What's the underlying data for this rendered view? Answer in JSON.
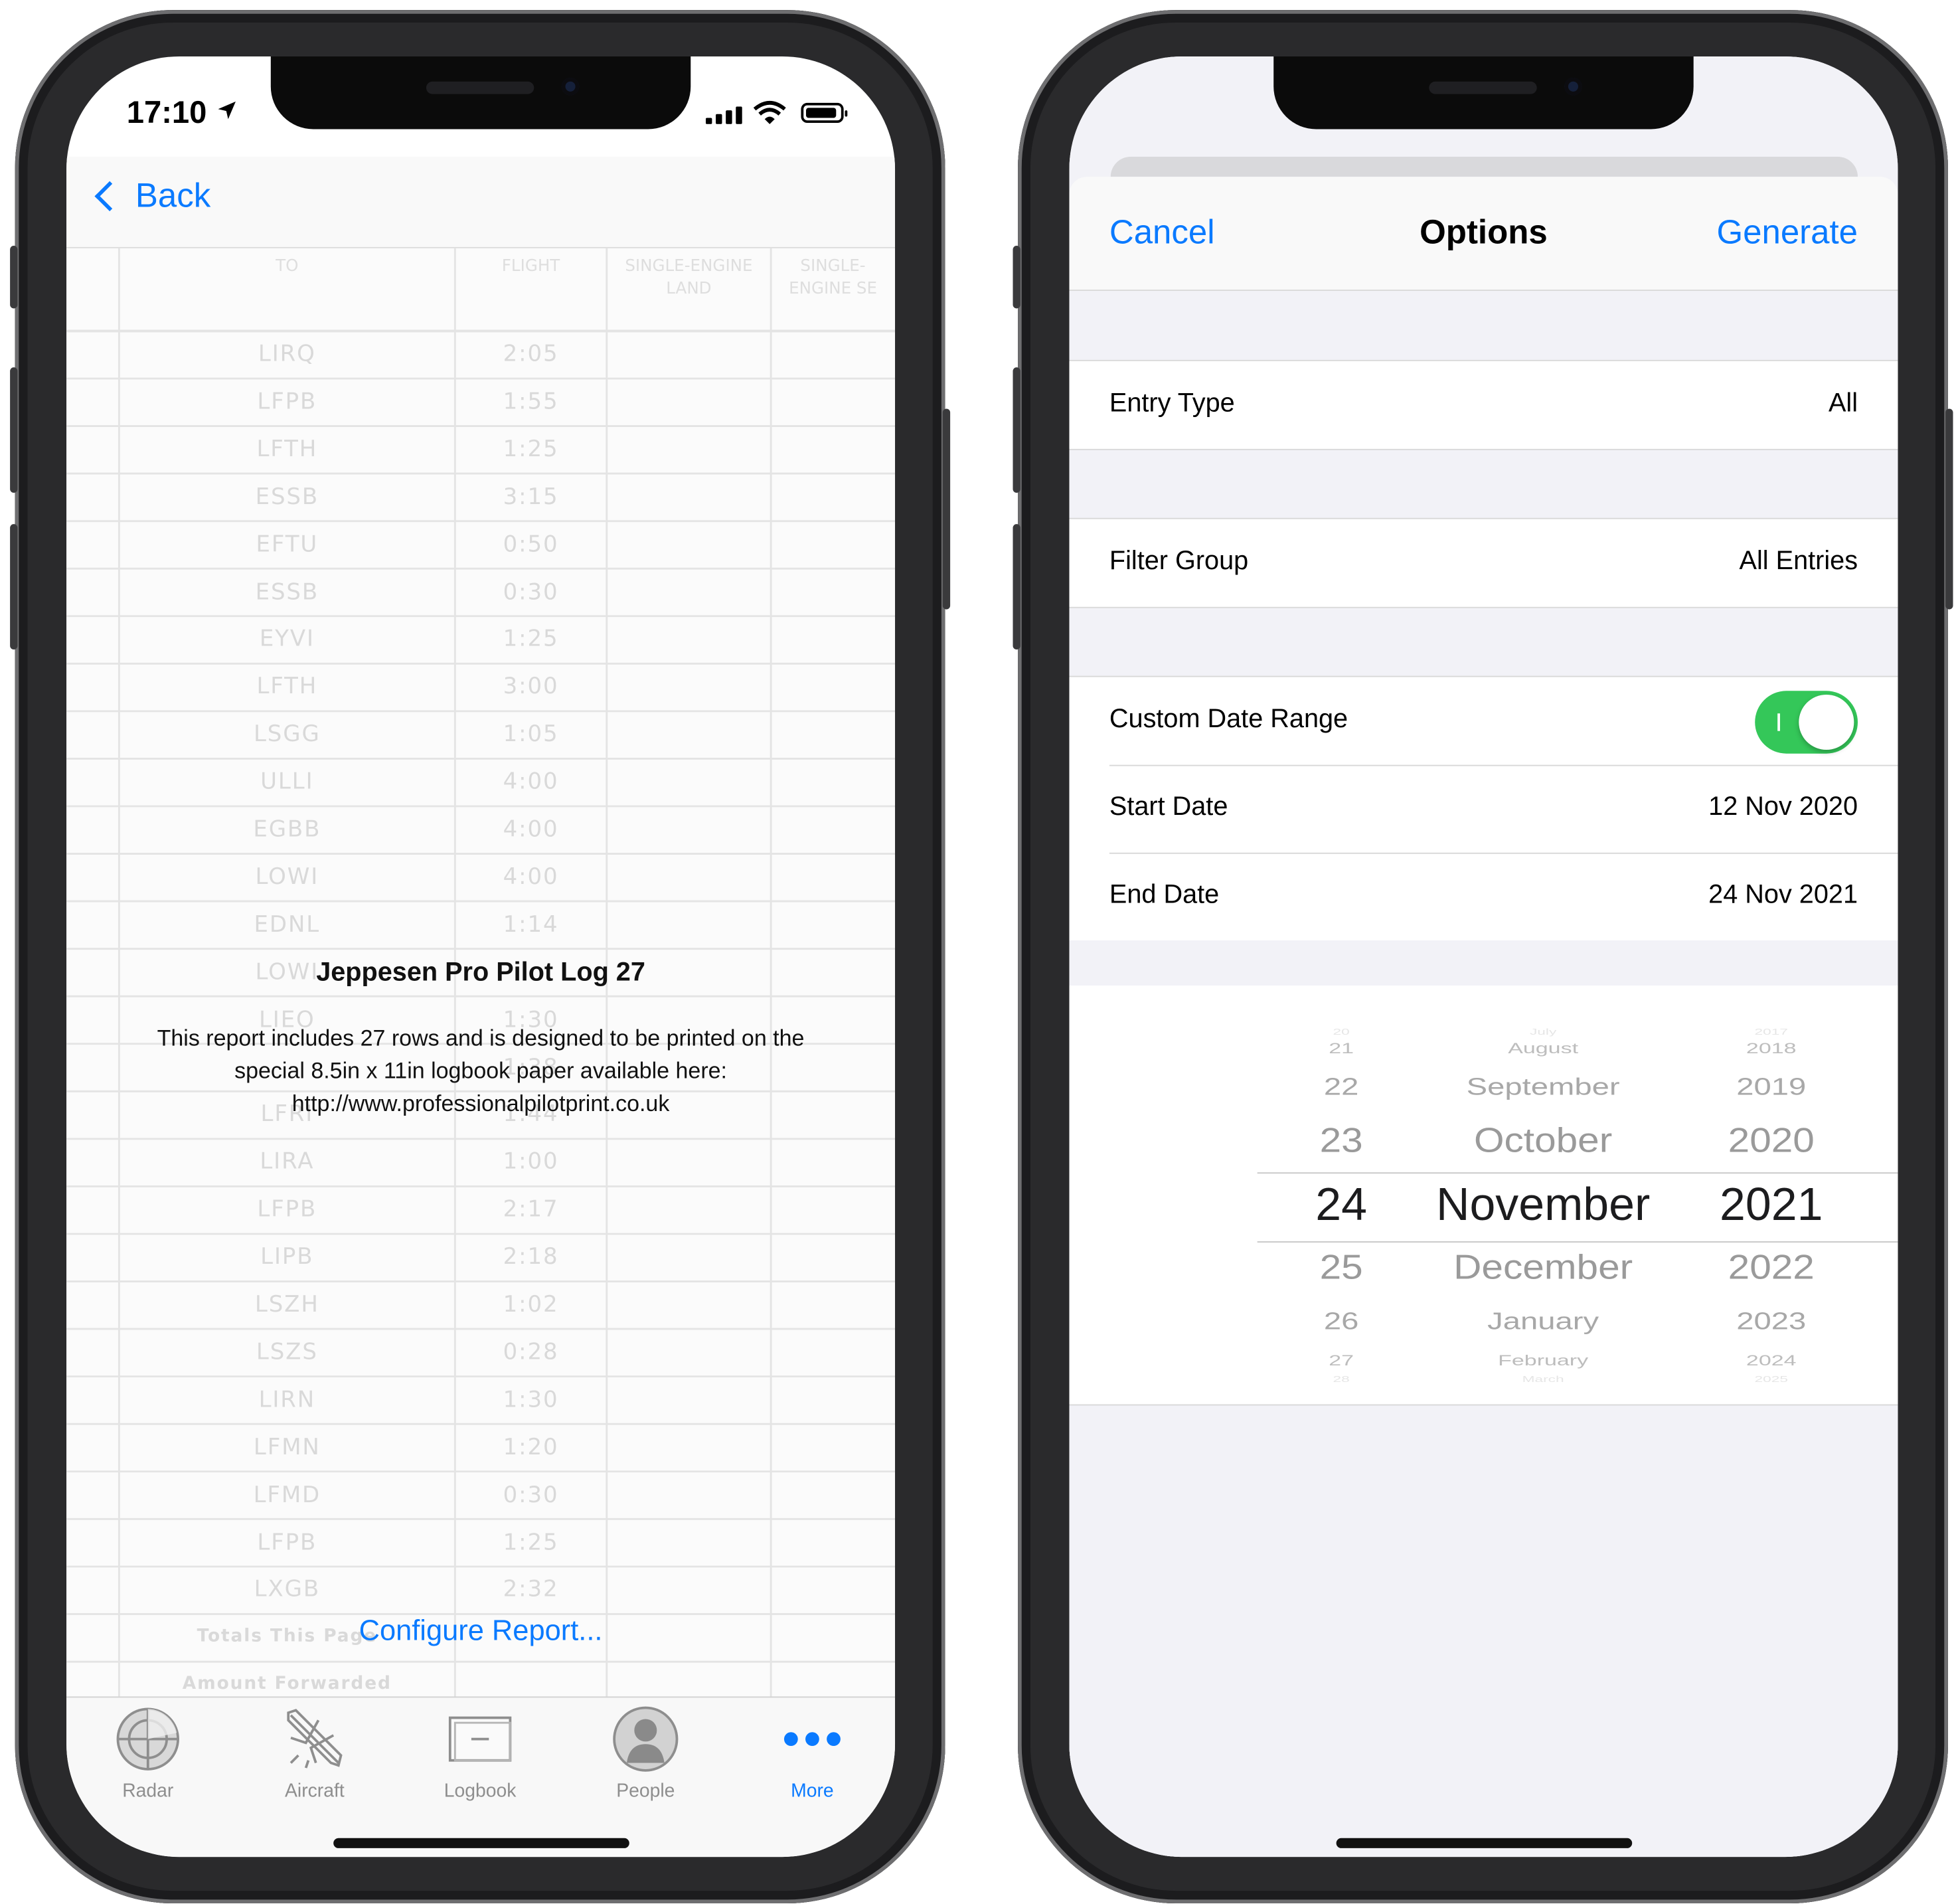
{
  "left_phone": {
    "status": {
      "time": "17:10"
    },
    "nav": {
      "back_label": "Back"
    },
    "report_preview": {
      "headers": [
        "TO",
        "FLIGHT",
        "SINGLE-ENGINE LAND",
        "SINGLE-ENGINE SE"
      ],
      "rows": [
        {
          "to": "LIRQ",
          "time": "2:05"
        },
        {
          "to": "LFPB",
          "time": "1:55"
        },
        {
          "to": "LFTH",
          "time": "1:25"
        },
        {
          "to": "ESSB",
          "time": "3:15"
        },
        {
          "to": "EFTU",
          "time": "0:50"
        },
        {
          "to": "ESSB",
          "time": "0:30"
        },
        {
          "to": "EYVI",
          "time": "1:25"
        },
        {
          "to": "LFTH",
          "time": "3:00"
        },
        {
          "to": "LSGG",
          "time": "1:05"
        },
        {
          "to": "ULLI",
          "time": "4:00"
        },
        {
          "to": "EGBB",
          "time": "4:00"
        },
        {
          "to": "LOWI",
          "time": "4:00"
        },
        {
          "to": "EDNL",
          "time": "1:14"
        },
        {
          "to": "LOWI",
          "time": ""
        },
        {
          "to": "LIEO",
          "time": "1:30"
        },
        {
          "to": "",
          "time": "1:38"
        },
        {
          "to": "LFRI",
          "time": "1:44"
        },
        {
          "to": "LIRA",
          "time": "1:00"
        },
        {
          "to": "LFPB",
          "time": "2:17"
        },
        {
          "to": "LIPB",
          "time": "2:18"
        },
        {
          "to": "LSZH",
          "time": "1:02"
        },
        {
          "to": "LSZS",
          "time": "0:28"
        },
        {
          "to": "LIRN",
          "time": "1:30"
        },
        {
          "to": "LFMN",
          "time": "1:20"
        },
        {
          "to": "LFMD",
          "time": "0:30"
        },
        {
          "to": "LFPB",
          "time": "1:25"
        },
        {
          "to": "LXGB",
          "time": "2:32"
        }
      ],
      "footer": [
        "Totals This Page",
        "Amount Forwarded"
      ]
    },
    "overlay": {
      "title": "Jeppesen Pro Pilot Log 27",
      "description": "This report includes 27 rows and is designed to be printed on the special 8.5in x 11in logbook paper available here: http://www.professionalpilotprint.co.uk"
    },
    "configure_label": "Configure Report...",
    "tabs": [
      {
        "label": "Radar",
        "icon": "radar-icon",
        "active": false
      },
      {
        "label": "Aircraft",
        "icon": "airplane-icon",
        "active": false
      },
      {
        "label": "Logbook",
        "icon": "logbook-icon",
        "active": false
      },
      {
        "label": "People",
        "icon": "person-icon",
        "active": false
      },
      {
        "label": "More",
        "icon": "more-dots-icon",
        "active": true
      }
    ]
  },
  "right_phone": {
    "sheet": {
      "cancel_label": "Cancel",
      "title": "Options",
      "generate_label": "Generate"
    },
    "entry_type": {
      "label": "Entry Type",
      "value": "All"
    },
    "filter_group": {
      "label": "Filter Group",
      "value": "All Entries"
    },
    "custom_date_range": {
      "label": "Custom Date Range",
      "enabled": true
    },
    "start_date": {
      "label": "Start Date",
      "value": "12 Nov 2020"
    },
    "end_date": {
      "label": "End Date",
      "value": "24 Nov 2021"
    },
    "picker": {
      "days": [
        "20",
        "21",
        "22",
        "23",
        "24",
        "25",
        "26",
        "27",
        "28"
      ],
      "months": [
        "July",
        "August",
        "September",
        "October",
        "November",
        "December",
        "January",
        "February",
        "March"
      ],
      "years": [
        "2017",
        "2018",
        "2019",
        "2020",
        "2021",
        "2022",
        "2023",
        "2024",
        "2025"
      ],
      "selected": {
        "day": "24",
        "month": "November",
        "year": "2021"
      }
    }
  },
  "colors": {
    "accent": "#0a7aff",
    "toggle_on": "#34c759",
    "grouped_bg": "#f2f2f7"
  }
}
